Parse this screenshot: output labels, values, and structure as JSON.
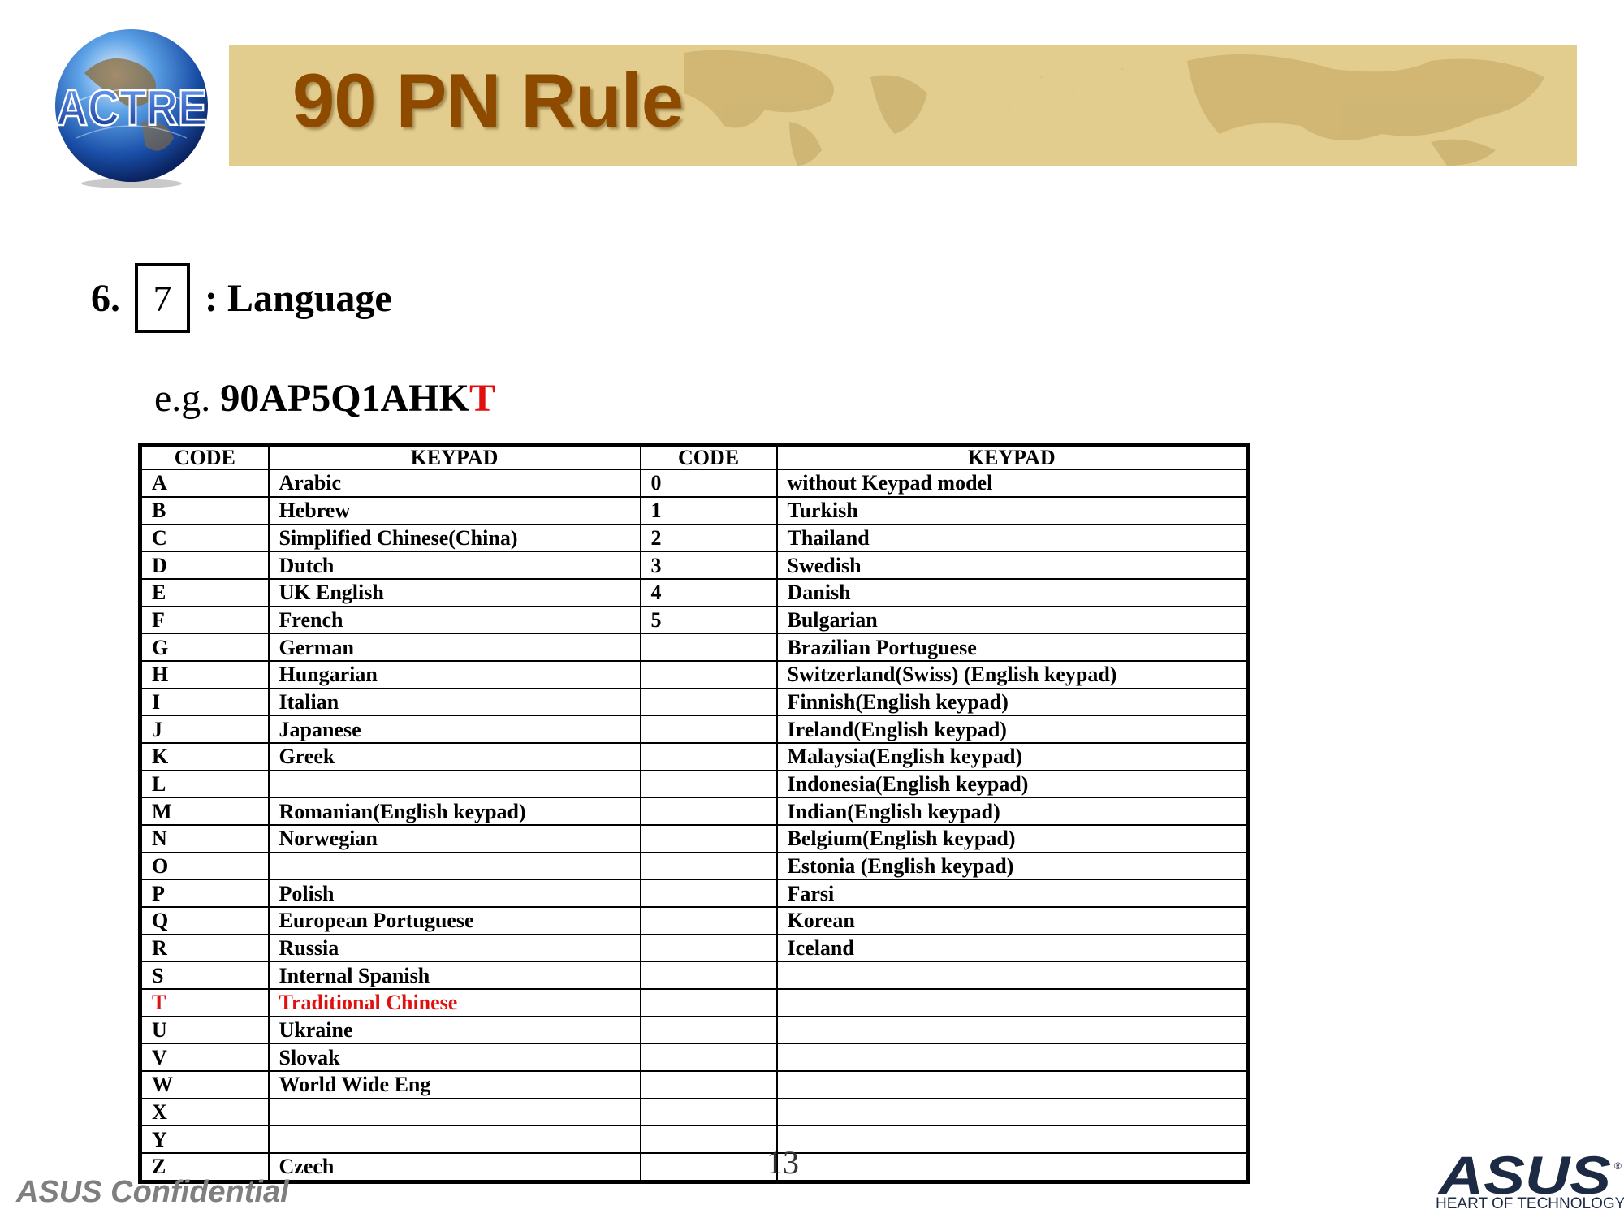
{
  "header": {
    "logo_text": "ACTRE",
    "title": "90 PN Rule"
  },
  "heading": {
    "number": "6.",
    "code_position": "7",
    "label": ": Language"
  },
  "example": {
    "prefix": "e.g.",
    "pn_main": "90AP5Q1AHK",
    "pn_highlight": "T"
  },
  "table": {
    "headers": [
      "CODE",
      "KEYPAD",
      "CODE",
      "KEYPAD"
    ],
    "highlight_color": "#e0100f",
    "rows": [
      {
        "c1": "A",
        "k1": "Arabic",
        "c2": "0",
        "k2": "without Keypad model"
      },
      {
        "c1": "B",
        "k1": "Hebrew",
        "c2": "1",
        "k2": "Turkish"
      },
      {
        "c1": "C",
        "k1": "Simplified Chinese(China)",
        "c2": "2",
        "k2": "Thailand"
      },
      {
        "c1": "D",
        "k1": "Dutch",
        "c2": "3",
        "k2": "Swedish"
      },
      {
        "c1": "E",
        "k1": "UK English",
        "c2": "4",
        "k2": "Danish"
      },
      {
        "c1": "F",
        "k1": "French",
        "c2": "5",
        "k2": "Bulgarian"
      },
      {
        "c1": "G",
        "k1": "German",
        "c2": "",
        "k2": "Brazilian Portuguese"
      },
      {
        "c1": "H",
        "k1": "Hungarian",
        "c2": "",
        "k2": "Switzerland(Swiss) (English keypad)"
      },
      {
        "c1": "I",
        "k1": "Italian",
        "c2": "",
        "k2": "Finnish(English keypad)"
      },
      {
        "c1": "J",
        "k1": "Japanese",
        "c2": "",
        "k2": "Ireland(English keypad)"
      },
      {
        "c1": "K",
        "k1": "Greek",
        "c2": "",
        "k2": "Malaysia(English keypad)"
      },
      {
        "c1": "L",
        "k1": "",
        "c2": "",
        "k2": "Indonesia(English keypad)"
      },
      {
        "c1": "M",
        "k1": "Romanian(English keypad)",
        "c2": "",
        "k2": "Indian(English keypad)"
      },
      {
        "c1": "N",
        "k1": "Norwegian",
        "c2": "",
        "k2": "Belgium(English keypad)"
      },
      {
        "c1": "O",
        "k1": "",
        "c2": "",
        "k2": "Estonia (English keypad)"
      },
      {
        "c1": "P",
        "k1": "Polish",
        "c2": "",
        "k2": "Farsi"
      },
      {
        "c1": "Q",
        "k1": "European Portuguese",
        "c2": "",
        "k2": "Korean"
      },
      {
        "c1": "R",
        "k1": "Russia",
        "c2": "",
        "k2": "Iceland"
      },
      {
        "c1": "S",
        "k1": "Internal Spanish",
        "c2": "",
        "k2": ""
      },
      {
        "c1": "T",
        "k1": "Traditional Chinese",
        "c2": "",
        "k2": "",
        "highlight": true
      },
      {
        "c1": "U",
        "k1": "Ukraine",
        "c2": "",
        "k2": ""
      },
      {
        "c1": "V",
        "k1": "Slovak",
        "c2": "",
        "k2": ""
      },
      {
        "c1": "W",
        "k1": "World Wide Eng",
        "c2": "",
        "k2": ""
      },
      {
        "c1": "X",
        "k1": "",
        "c2": "",
        "k2": ""
      },
      {
        "c1": "Y",
        "k1": "",
        "c2": "",
        "k2": ""
      },
      {
        "c1": "Z",
        "k1": "Czech",
        "c2": "",
        "k2": ""
      }
    ]
  },
  "footer": {
    "confidential": "ASUS Confidential",
    "page_number": "13",
    "brand": "ASUS",
    "tagline": "HEART OF TECHNOLOGY"
  }
}
